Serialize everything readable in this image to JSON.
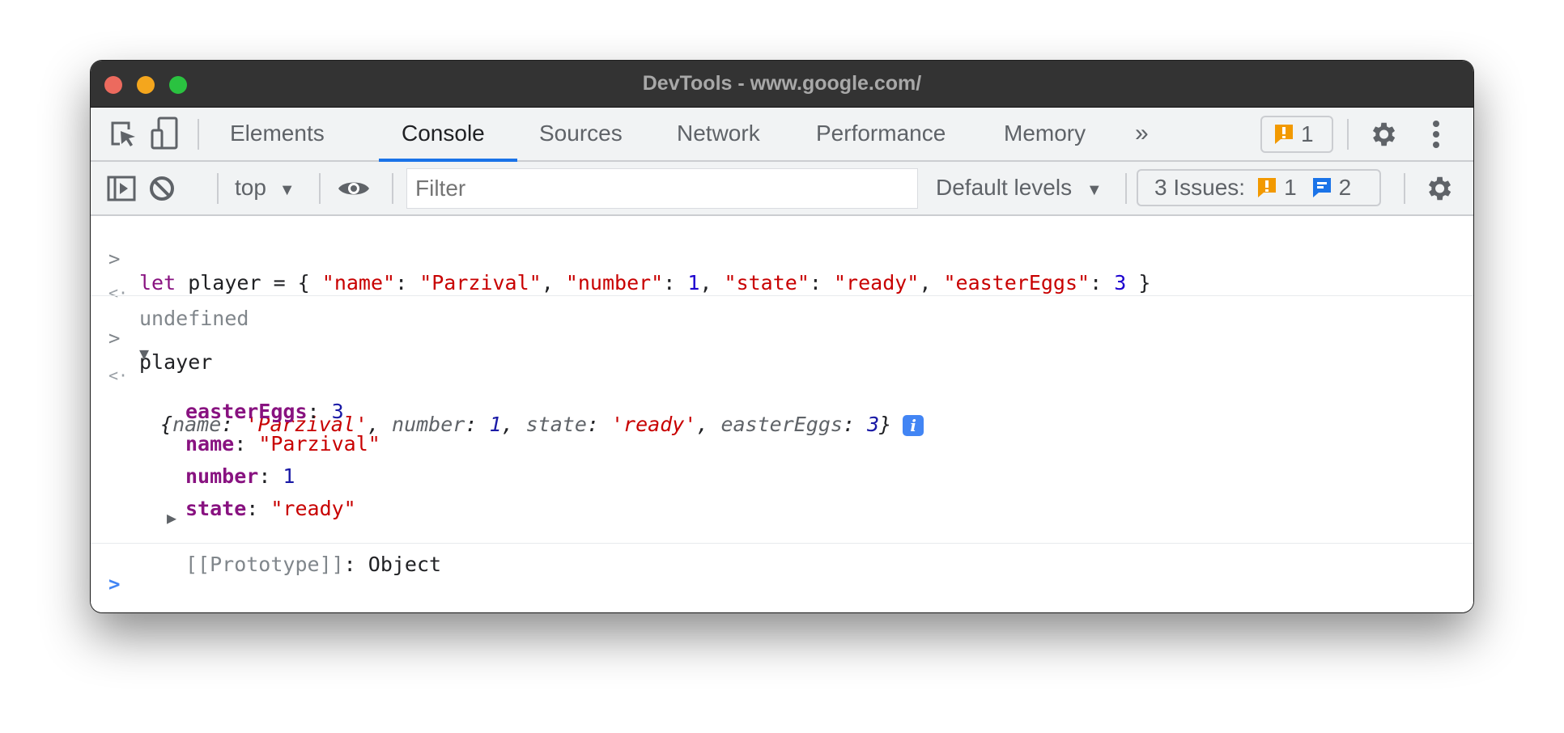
{
  "window": {
    "title": "DevTools - www.google.com/"
  },
  "main_toolbar": {
    "icons": [
      "inspect-element-icon",
      "device-toolbar-icon"
    ],
    "tabs": [
      {
        "label": "Elements",
        "active": false
      },
      {
        "label": "Console",
        "active": true
      },
      {
        "label": "Sources",
        "active": false
      },
      {
        "label": "Network",
        "active": false
      },
      {
        "label": "Performance",
        "active": false
      },
      {
        "label": "Memory",
        "active": false
      }
    ],
    "more_tabs_icon": "»",
    "warnings_count": "1",
    "settings_icon": "gear-icon",
    "menu_icon": "kebab-menu-icon"
  },
  "console_toolbar": {
    "context_selector": "top",
    "filter_placeholder": "Filter",
    "levels_label": "Default levels",
    "issues_label": "3 Issues:",
    "issues_warning_count": "1",
    "issues_info_count": "2"
  },
  "colors": {
    "accent": "#1a73e8",
    "warning": "#f29900",
    "info": "#1a73e8",
    "titlebar": "#333333"
  },
  "console": {
    "entries": [
      {
        "type": "input",
        "tokens": [
          {
            "t": "let",
            "c": "kw"
          },
          {
            "t": " player = { ",
            "c": ""
          },
          {
            "t": "\"name\"",
            "c": "str"
          },
          {
            "t": ": ",
            "c": ""
          },
          {
            "t": "\"Parzival\"",
            "c": "str"
          },
          {
            "t": ", ",
            "c": ""
          },
          {
            "t": "\"number\"",
            "c": "str"
          },
          {
            "t": ": ",
            "c": ""
          },
          {
            "t": "1",
            "c": "num2"
          },
          {
            "t": ", ",
            "c": ""
          },
          {
            "t": "\"state\"",
            "c": "str"
          },
          {
            "t": ": ",
            "c": ""
          },
          {
            "t": "\"ready\"",
            "c": "str"
          },
          {
            "t": ", ",
            "c": ""
          },
          {
            "t": "\"easterEggs\"",
            "c": "str"
          },
          {
            "t": ": ",
            "c": ""
          },
          {
            "t": "3",
            "c": "num2"
          },
          {
            "t": " }",
            "c": ""
          }
        ]
      },
      {
        "type": "result",
        "text": "undefined"
      },
      {
        "type": "input",
        "text": "player"
      },
      {
        "type": "result-object",
        "preview": [
          {
            "t": "{",
            "c": "ital"
          },
          {
            "t": "name",
            "c": "preview-key"
          },
          {
            "t": ": ",
            "c": "ital"
          },
          {
            "t": "'Parzival'",
            "c": "str ital"
          },
          {
            "t": ", ",
            "c": "ital"
          },
          {
            "t": "number",
            "c": "preview-key"
          },
          {
            "t": ": ",
            "c": "ital"
          },
          {
            "t": "1",
            "c": "num ital"
          },
          {
            "t": ", ",
            "c": "ital"
          },
          {
            "t": "state",
            "c": "preview-key"
          },
          {
            "t": ": ",
            "c": "ital"
          },
          {
            "t": "'ready'",
            "c": "str ital"
          },
          {
            "t": ", ",
            "c": "ital"
          },
          {
            "t": "easterEggs",
            "c": "preview-key"
          },
          {
            "t": ": ",
            "c": "ital"
          },
          {
            "t": "3",
            "c": "num ital"
          },
          {
            "t": "}",
            "c": "ital"
          }
        ],
        "info_badge": "i",
        "properties": [
          {
            "key": "easterEggs",
            "value": "3",
            "kind": "num"
          },
          {
            "key": "name",
            "value": "\"Parzival\"",
            "kind": "str"
          },
          {
            "key": "number",
            "value": "1",
            "kind": "num"
          },
          {
            "key": "state",
            "value": "\"ready\"",
            "kind": "str"
          }
        ],
        "prototype": {
          "key": "[[Prototype]]",
          "value": "Object"
        }
      }
    ],
    "prompt_glyph": ">",
    "result_glyph": "<·"
  }
}
